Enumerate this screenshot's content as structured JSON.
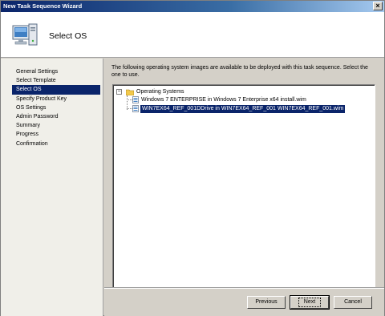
{
  "window": {
    "title": "New Task Sequence Wizard",
    "close_label": "×"
  },
  "header": {
    "title": "Select OS",
    "icon": "computer-icon"
  },
  "sidebar": {
    "items": [
      {
        "label": "General Settings",
        "selected": false
      },
      {
        "label": "Select Template",
        "selected": false
      },
      {
        "label": "Select OS",
        "selected": true
      },
      {
        "label": "Specify Product Key",
        "selected": false
      },
      {
        "label": "OS Settings",
        "selected": false
      },
      {
        "label": "Admin Password",
        "selected": false
      },
      {
        "label": "Summary",
        "selected": false
      },
      {
        "label": "Progress",
        "selected": false
      },
      {
        "label": "Confirmation",
        "selected": false
      }
    ]
  },
  "main": {
    "description": "The following operating system images are available to be deployed with this task sequence.  Select the one to use.",
    "tree": {
      "root_label": "Operating Systems",
      "expander": "−",
      "items": [
        {
          "label": "Windows 7 ENTERPRISE in Windows 7 Enterprise x64 install.wim",
          "selected": false
        },
        {
          "label": "WIN7EX64_REF_001DDrive in WIN7EX64_REF_001 WIN7EX64_REF_001.wim",
          "selected": true
        }
      ]
    }
  },
  "footer": {
    "previous_label": "Previous",
    "next_label": "Next",
    "cancel_label": "Cancel"
  },
  "colors": {
    "title_bar": "#0a246a",
    "selection": "#0a246a",
    "window_bg": "#d4d0c8"
  }
}
